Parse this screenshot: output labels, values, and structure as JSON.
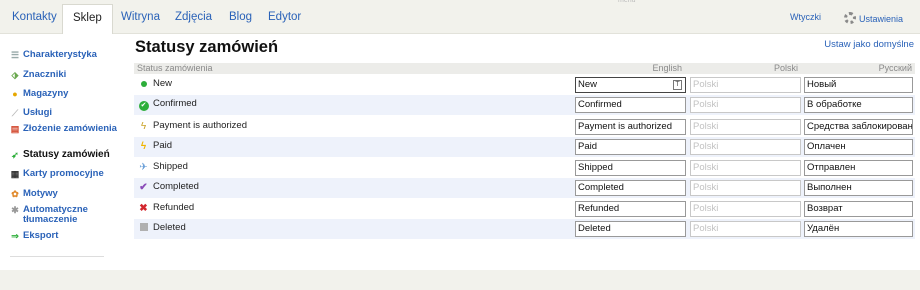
{
  "topbar": {
    "tabs": [
      {
        "label": "Kontakty",
        "active": false
      },
      {
        "label": "Sklep",
        "active": true
      },
      {
        "label": "Witryna",
        "active": false
      },
      {
        "label": "Zdjęcia",
        "active": false
      },
      {
        "label": "Blog",
        "active": false
      },
      {
        "label": "Edytor",
        "active": false
      }
    ],
    "menu_hint": "menu",
    "plugins": "Wtyczki",
    "settings": "Ustawienia"
  },
  "sidebar": {
    "items": [
      {
        "label": "Charakterystyka",
        "icon": "list-icon"
      },
      {
        "label": "Znaczniki",
        "icon": "tag-icon"
      },
      {
        "label": "Magazyny",
        "icon": "warehouse-icon"
      },
      {
        "label": "Usługi",
        "icon": "service-icon"
      },
      {
        "label": "Złożenie zamówienia",
        "icon": "calendar-icon"
      },
      {
        "label": "Statusy zamówień",
        "icon": "status-icon",
        "active": true
      },
      {
        "label": "Karty promocyjne",
        "icon": "card-icon"
      },
      {
        "label": "Motywy",
        "icon": "theme-icon"
      },
      {
        "label": "Automatyczne tłumaczenie",
        "icon": "translate-icon"
      },
      {
        "label": "Eksport",
        "icon": "arrow-right-icon"
      }
    ]
  },
  "main": {
    "title": "Statusy zamówień",
    "set_default": "Ustaw jako domyślne",
    "columns": [
      "Status zamówienia",
      "English",
      "Polski",
      "Русский"
    ],
    "polish_placeholder": "Polski",
    "rows": [
      {
        "name": "New",
        "icon": "green-dot-icon",
        "en": "New",
        "ru": "Новый"
      },
      {
        "name": "Confirmed",
        "icon": "green-check-icon",
        "en": "Confirmed",
        "ru": "В обработке"
      },
      {
        "name": "Payment is authorized",
        "icon": "lightning-outline-icon",
        "en": "Payment is authorized",
        "ru": "Средства заблокированы"
      },
      {
        "name": "Paid",
        "icon": "lightning-icon",
        "en": "Paid",
        "ru": "Оплачен"
      },
      {
        "name": "Shipped",
        "icon": "plane-icon",
        "en": "Shipped",
        "ru": "Отправлен"
      },
      {
        "name": "Completed",
        "icon": "purple-check-icon",
        "en": "Completed",
        "ru": "Выполнен"
      },
      {
        "name": "Refunded",
        "icon": "red-x-icon",
        "en": "Refunded",
        "ru": "Возврат"
      },
      {
        "name": "Deleted",
        "icon": "trash-icon",
        "en": "Deleted",
        "ru": "Удалён"
      }
    ]
  },
  "colors": {
    "link": "#2a62b8",
    "row_alt": "#eef2fb",
    "header_bg": "#ecece9"
  }
}
